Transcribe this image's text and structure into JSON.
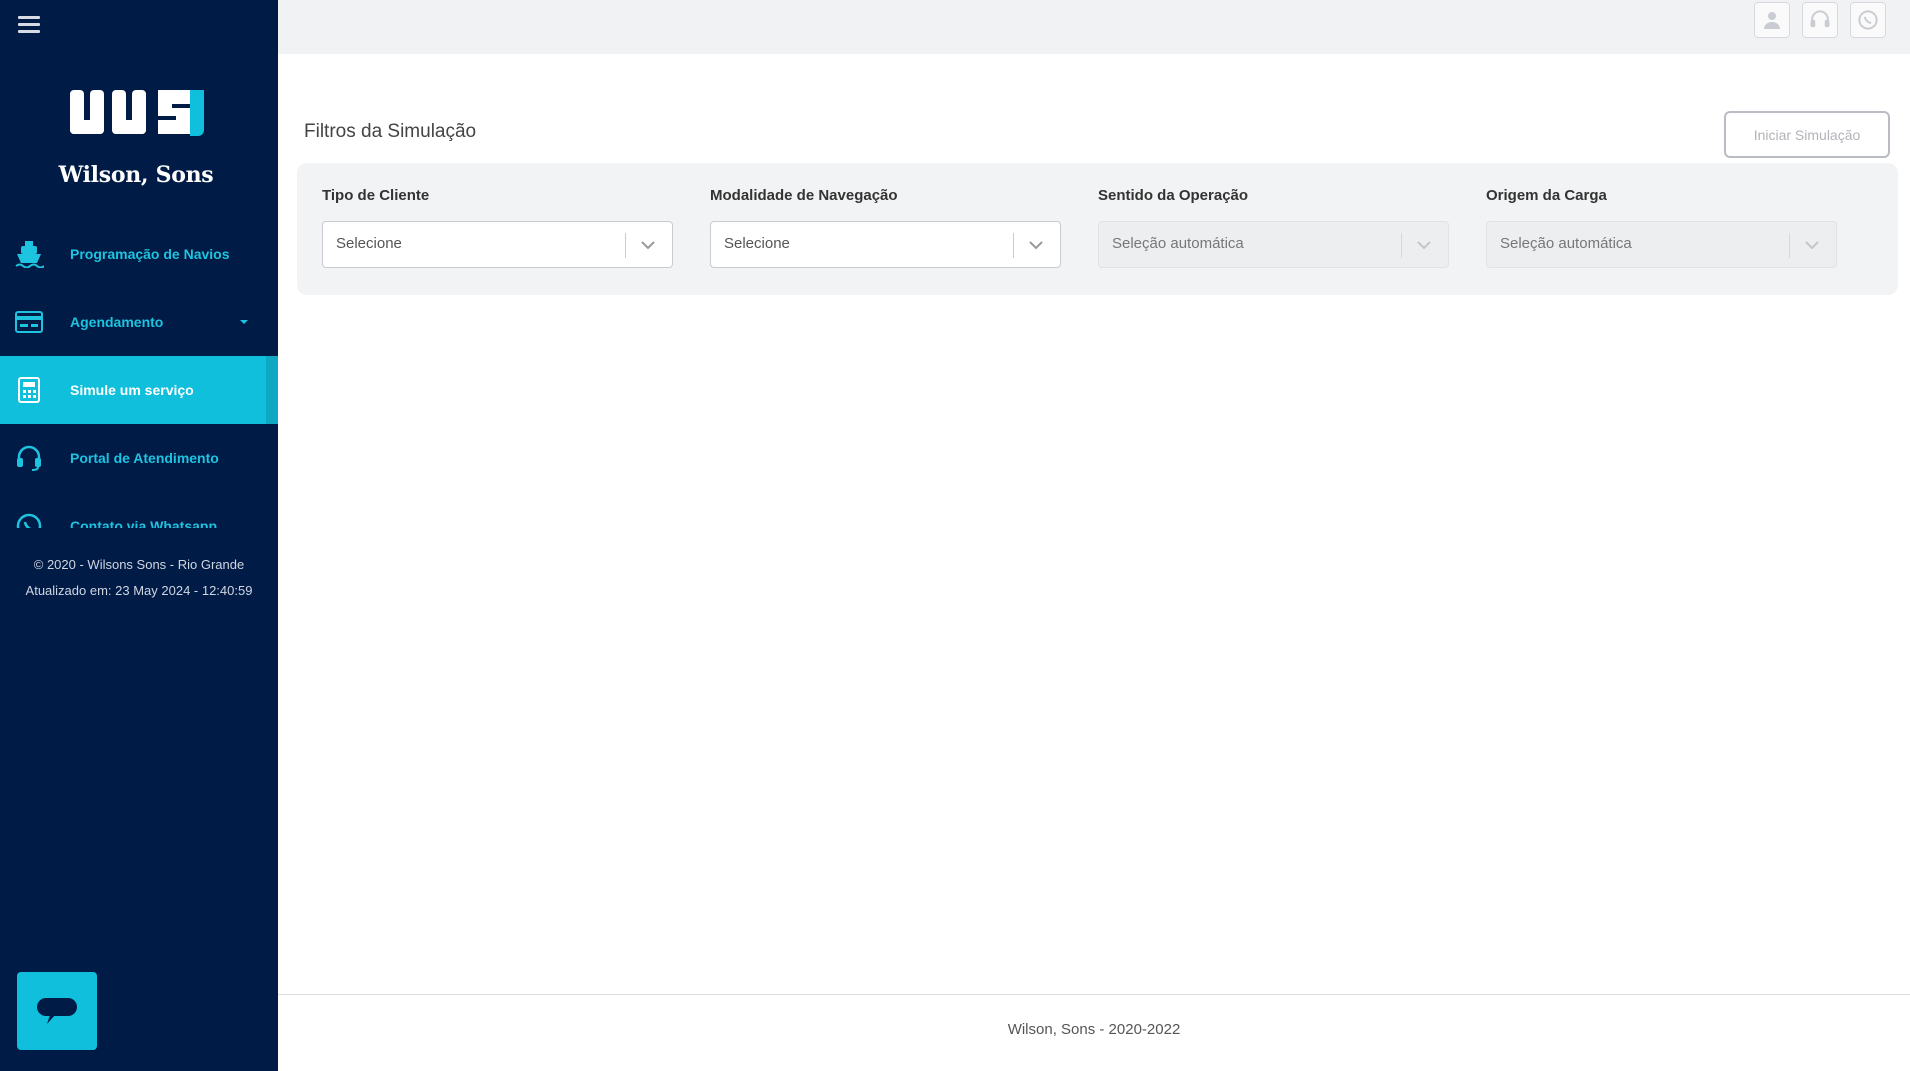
{
  "sidebar": {
    "logo_text": "Wilson, Sons",
    "nav_items": [
      {
        "label": "Programação de Navios",
        "icon": "ship-icon"
      },
      {
        "label": "Agendamento",
        "icon": "card-icon"
      },
      {
        "label": "Simule um serviço",
        "icon": "calculator-icon",
        "active": true
      },
      {
        "label": "Portal de Atendimento",
        "icon": "headset-icon"
      },
      {
        "label": "Contato via Whatsapp",
        "icon": "whatsapp-icon"
      }
    ],
    "footer_copyright": "© 2020 - Wilsons Sons - Rio Grande",
    "footer_updated": "Atualizado em: 23 May 2024 - 12:40:59"
  },
  "main": {
    "title": "Filtros da Simulação",
    "start_button": "Iniciar Simulação",
    "filters": [
      {
        "label": "Tipo de Cliente",
        "value": "Selecione",
        "disabled": false
      },
      {
        "label": "Modalidade de Navegação",
        "value": "Selecione",
        "disabled": false
      },
      {
        "label": "Sentido da Operação",
        "value": "Seleção automática",
        "disabled": true
      },
      {
        "label": "Origem da Carga",
        "value": "Seleção automática",
        "disabled": true
      }
    ]
  },
  "footer": {
    "text": "Wilson, Sons - 2020-2022"
  },
  "colors": {
    "sidebar_bg": "#001b45",
    "accent": "#10bfdc"
  }
}
